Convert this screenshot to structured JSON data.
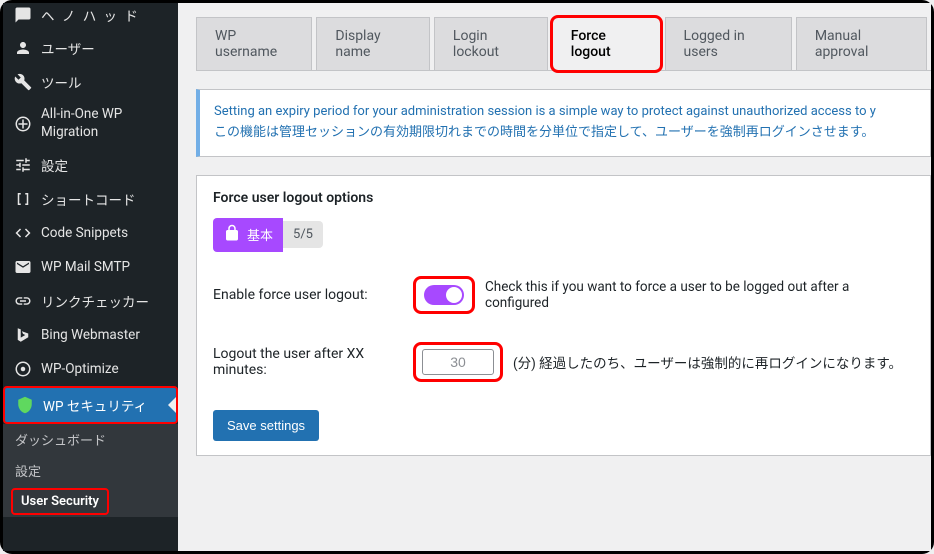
{
  "sidebar": {
    "items": [
      {
        "label": "ユーザー"
      },
      {
        "label": "ツール"
      },
      {
        "label": "All-in-One WP Migration"
      },
      {
        "label": "設定"
      },
      {
        "label": "ショートコード"
      },
      {
        "label": "Code Snippets"
      },
      {
        "label": "WP Mail SMTP"
      },
      {
        "label": "リンクチェッカー"
      },
      {
        "label": "Bing Webmaster"
      },
      {
        "label": "WP-Optimize"
      },
      {
        "label": "WP セキュリティ"
      }
    ],
    "sub": [
      {
        "label": "ダッシュボード"
      },
      {
        "label": "設定"
      },
      {
        "label": "User Security"
      }
    ]
  },
  "tabs": [
    {
      "label": "WP username"
    },
    {
      "label": "Display name"
    },
    {
      "label": "Login lockout"
    },
    {
      "label": "Force logout"
    },
    {
      "label": "Logged in users"
    },
    {
      "label": "Manual approval"
    }
  ],
  "notice": {
    "line1": "Setting an expiry period for your administration session is a simple way to protect against unauthorized access to y",
    "line2": "この機能は管理セッションの有効期限切れまでの時間を分単位で指定して、ユーザーを強制再ログインさせます。"
  },
  "card": {
    "title": "Force user logout options",
    "badge_label": "基本",
    "badge_count": "5/5",
    "enable_label": "Enable force user logout:",
    "enable_desc": "Check this if you want to force a user to be logged out after a configured",
    "minutes_label": "Logout the user after XX minutes:",
    "minutes_value": "30",
    "minutes_desc": "(分) 経過したのち、ユーザーは強制的に再ログインになります。",
    "save_label": "Save settings"
  }
}
